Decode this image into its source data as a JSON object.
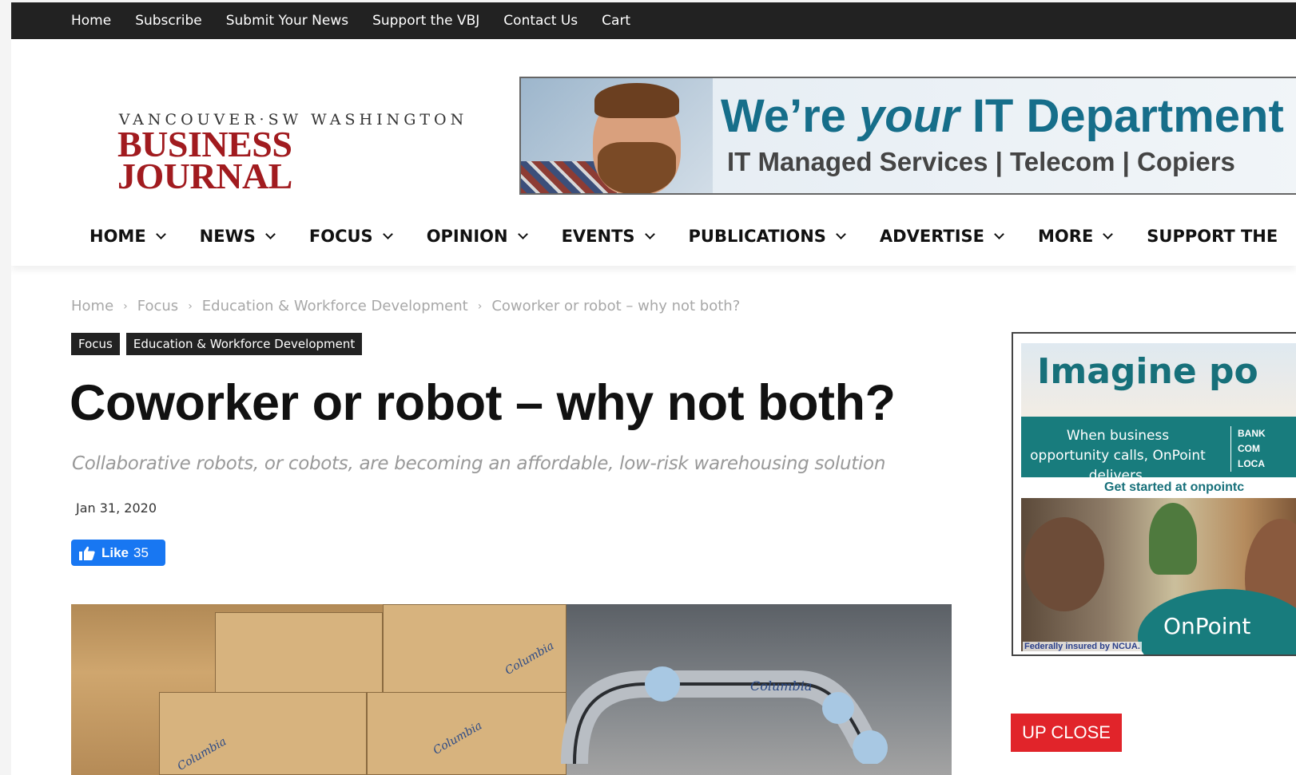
{
  "topbar": {
    "links": [
      "Home",
      "Subscribe",
      "Submit Your News",
      "Support the VBJ",
      "Contact Us",
      "Cart"
    ]
  },
  "logo": {
    "line1": "VANCOUVER·SW WASHINGTON",
    "line2": "BUSINESS JOURNAL"
  },
  "banner_ad": {
    "headline_pre": "We’re ",
    "headline_em": "your",
    "headline_post": " IT Department",
    "subline": "IT Managed Services | Telecom | Copiers"
  },
  "mainnav": {
    "items": [
      "HOME",
      "NEWS",
      "FOCUS",
      "OPINION",
      "EVENTS",
      "PUBLICATIONS",
      "ADVERTISE",
      "MORE",
      "SUPPORT THE"
    ]
  },
  "breadcrumb": {
    "items": [
      "Home",
      "Focus",
      "Education & Workforce Development",
      "Coworker or robot – why not both?"
    ],
    "separator": "›"
  },
  "tags": [
    "Focus",
    "Education & Workforce Development"
  ],
  "article": {
    "title": "Coworker or robot – why not both?",
    "subtitle": "Collaborative robots, or cobots, are becoming an affordable, low-risk warehousing solution",
    "date": "Jan 31, 2020"
  },
  "like_button": {
    "label": "Like",
    "count": "35"
  },
  "hero_image": {
    "box_label": "Columbia"
  },
  "side_ad": {
    "headline": "Imagine po",
    "teal_text": "When business opportunity calls, OnPoint delivers.",
    "teal_right": [
      "BANK",
      "COM",
      "LOCA"
    ],
    "cta": "Get started at onpointc",
    "brand": "OnPoint",
    "disclaimer": "Federally insured by NCUA."
  },
  "upclose_label": "UP CLOSE",
  "colors": {
    "topbar": "#222222",
    "logo_red": "#a11b1f",
    "banner_blue": "#166e8a",
    "facebook_blue": "#1877f2",
    "teal": "#187c7d",
    "upclose_red": "#e1242a"
  }
}
